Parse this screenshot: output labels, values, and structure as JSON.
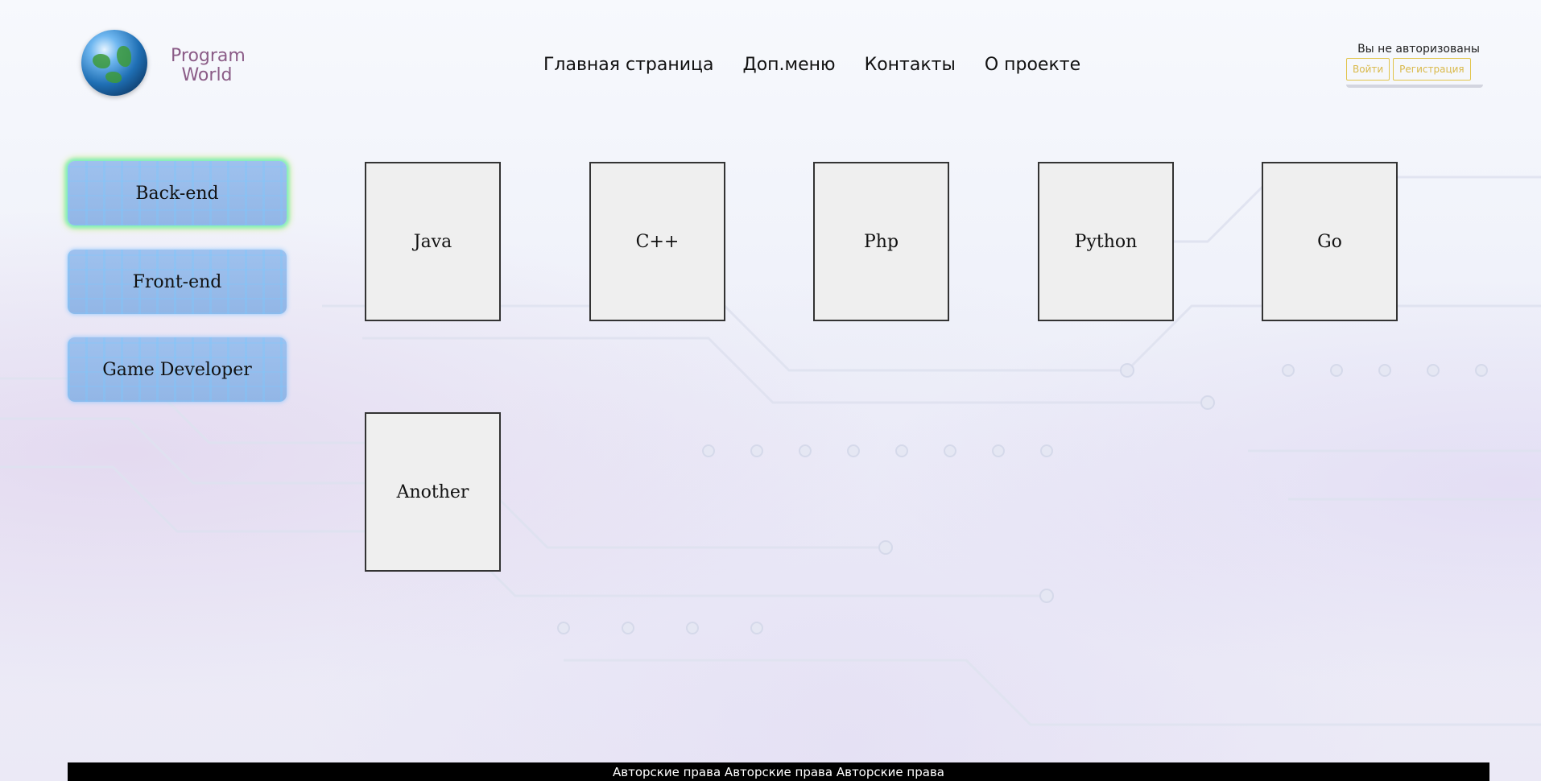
{
  "header": {
    "logo_line1": "Program",
    "logo_line2": "World",
    "nav": [
      "Главная страница",
      "Доп.меню",
      "Контакты",
      "О проекте"
    ]
  },
  "auth": {
    "status": "Вы не авторизованы",
    "login_label": "Войти",
    "register_label": "Регистрация"
  },
  "sidebar": {
    "items": [
      {
        "label": "Back-end",
        "active": true
      },
      {
        "label": "Front-end",
        "active": false
      },
      {
        "label": "Game Developer",
        "active": false
      }
    ]
  },
  "tiles": [
    "Java",
    "C++",
    "Php",
    "Python",
    "Go",
    "Another"
  ],
  "footer": {
    "text": "Авторские права Авторские права Авторские права"
  },
  "colors": {
    "logo_text": "#8b5c87",
    "auth_accent": "#e1c44a",
    "footer_bg": "#000000"
  }
}
